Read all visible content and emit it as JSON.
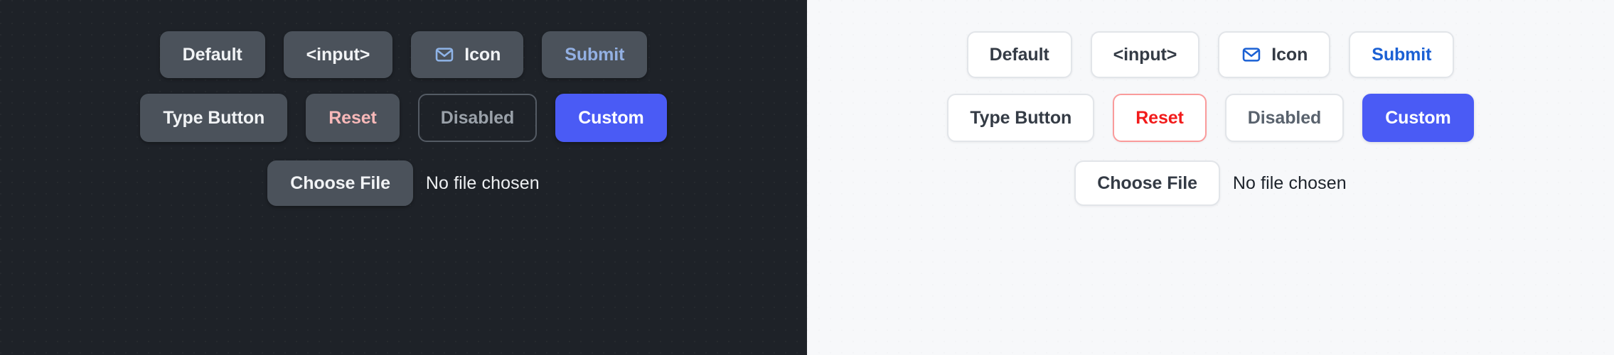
{
  "themes": [
    {
      "name": "dark",
      "rows": {
        "row1": [
          {
            "label": "Default",
            "kind": "btn-default",
            "icon": null
          },
          {
            "label": "<input>",
            "kind": "btn-input",
            "icon": null
          },
          {
            "label": "Icon",
            "kind": "btn-icon",
            "icon": "envelope-icon"
          },
          {
            "label": "Submit",
            "kind": "btn-submit",
            "icon": null
          }
        ],
        "row2": [
          {
            "label": "Type Button",
            "kind": "btn-type",
            "icon": null
          },
          {
            "label": "Reset",
            "kind": "btn-reset",
            "icon": null
          },
          {
            "label": "Disabled",
            "kind": "btn-disabled",
            "icon": null
          },
          {
            "label": "Custom",
            "kind": "btn-custom",
            "icon": null
          }
        ],
        "row3": {
          "button_label": "Choose File",
          "status_text": "No file chosen"
        }
      },
      "colors": {
        "background": "#1e2228",
        "button_surface": "#4b525b",
        "text": "#f1f3f5",
        "submit_text": "#93b0e3",
        "reset_text": "#f8b9b9",
        "disabled_text": "#9aa1a9",
        "disabled_border": "#545b64",
        "custom_accent": "#4a5bf5",
        "icon_accent": "#8fb4e8"
      }
    },
    {
      "name": "light",
      "rows": {
        "row1": [
          {
            "label": "Default",
            "kind": "btn-default",
            "icon": null
          },
          {
            "label": "<input>",
            "kind": "btn-input",
            "icon": null
          },
          {
            "label": "Icon",
            "kind": "btn-icon",
            "icon": "envelope-icon"
          },
          {
            "label": "Submit",
            "kind": "btn-submit",
            "icon": null
          }
        ],
        "row2": [
          {
            "label": "Type Button",
            "kind": "btn-type",
            "icon": null
          },
          {
            "label": "Reset",
            "kind": "btn-reset",
            "icon": null
          },
          {
            "label": "Disabled",
            "kind": "btn-disabled",
            "icon": null
          },
          {
            "label": "Custom",
            "kind": "btn-custom",
            "icon": null
          }
        ],
        "row3": {
          "button_label": "Choose File",
          "status_text": "No file chosen"
        }
      },
      "colors": {
        "background": "#f7f8fa",
        "button_surface": "#ffffff",
        "border": "#e2e5e9",
        "text": "#343b45",
        "submit_text": "#1b60d4",
        "reset_text": "#f21b1b",
        "reset_border": "#fa9b9b",
        "disabled_text": "#59626d",
        "custom_accent": "#4a5bf5",
        "icon_accent": "#1b60d4"
      }
    }
  ]
}
